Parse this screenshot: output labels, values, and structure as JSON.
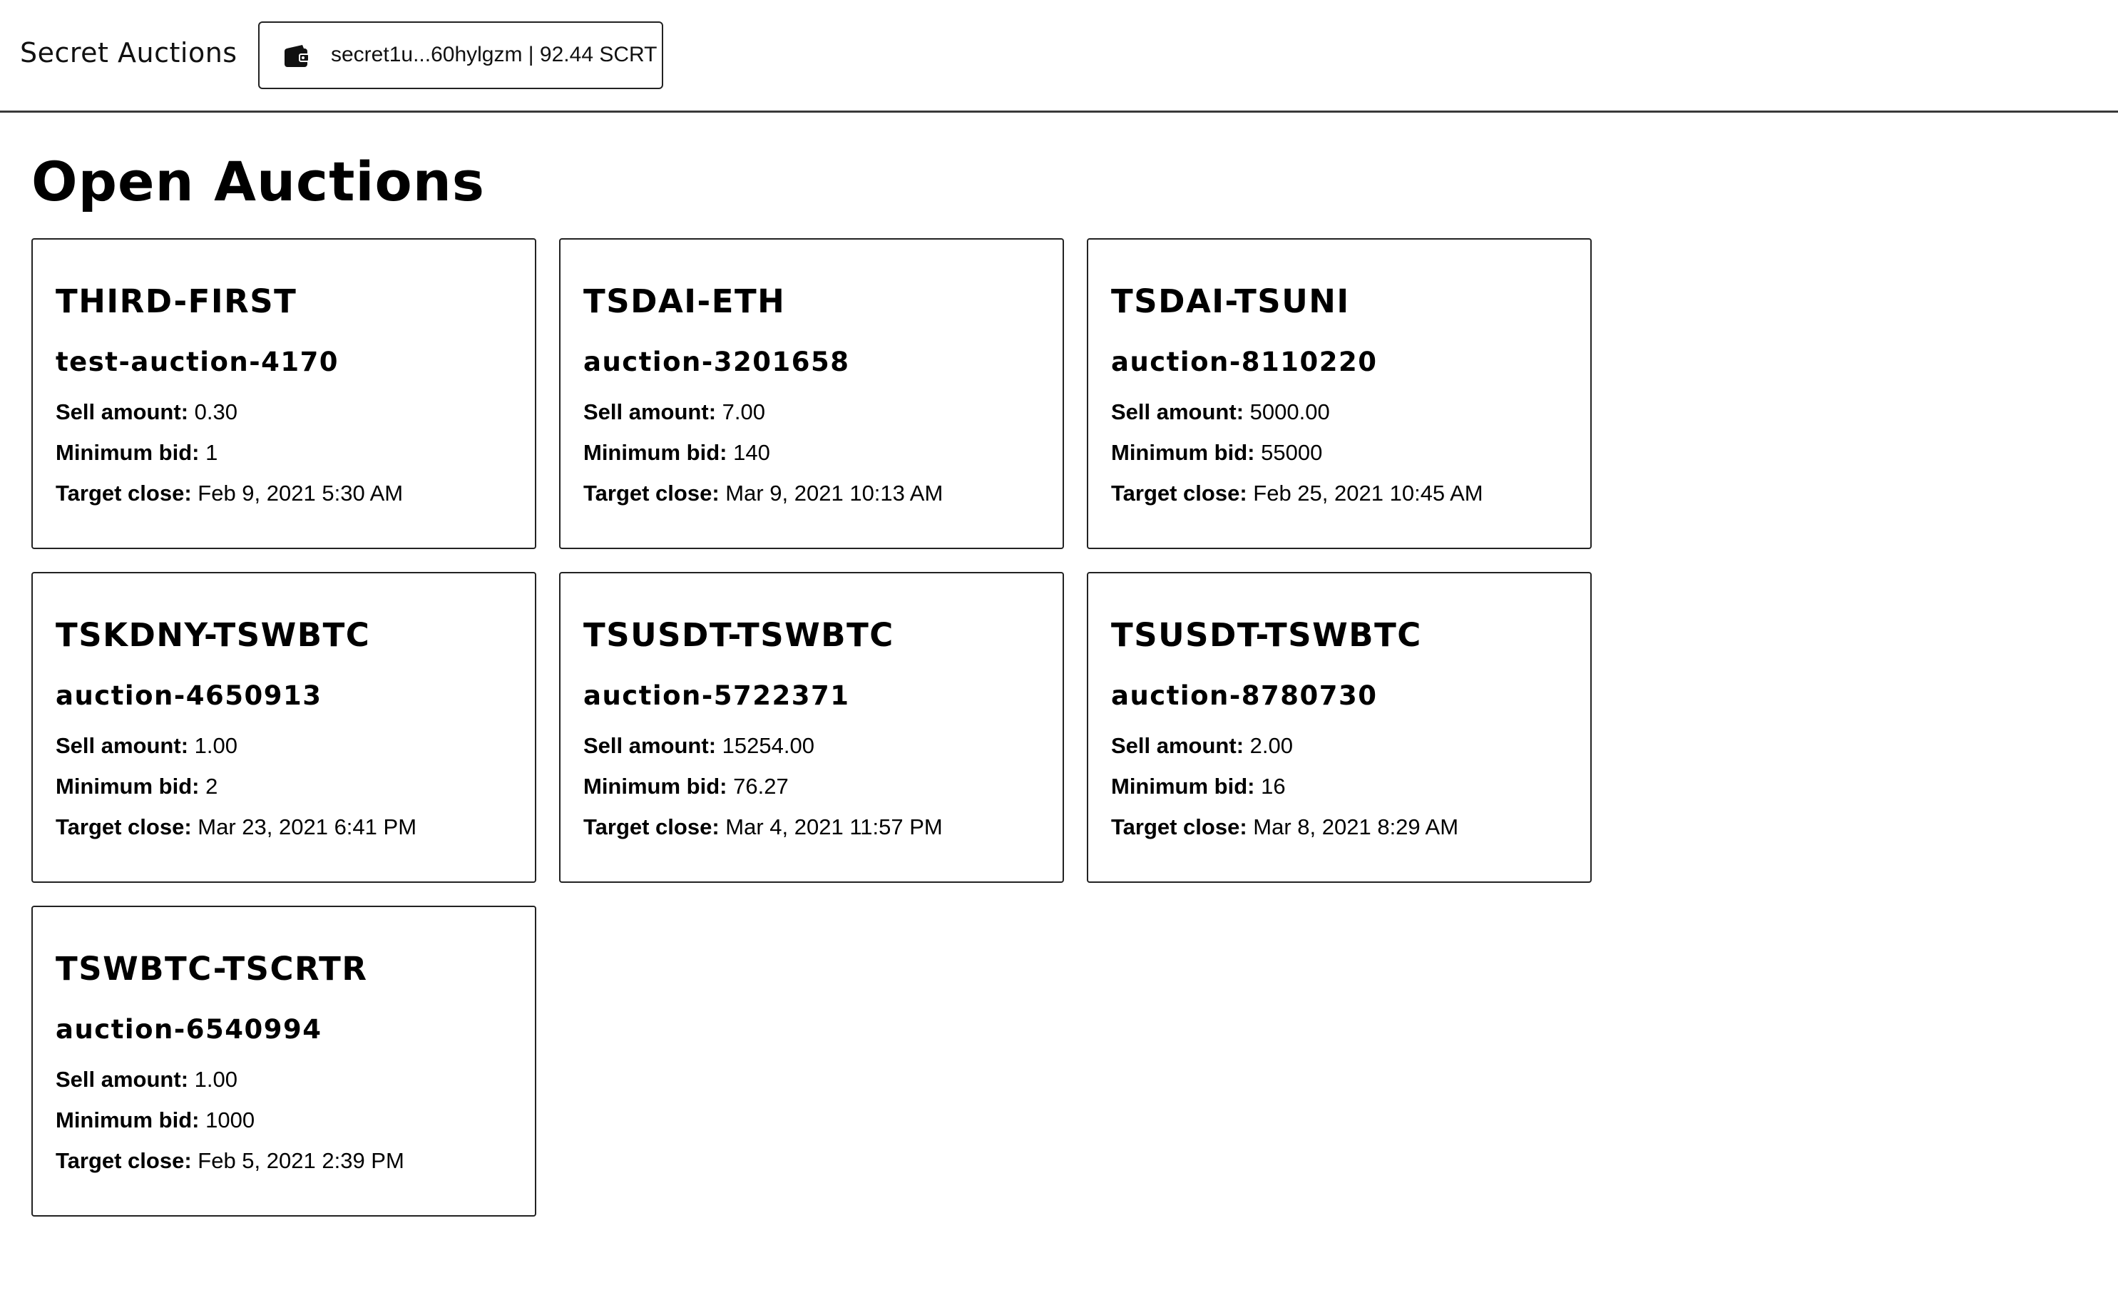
{
  "header": {
    "app_title": "Secret Auctions",
    "wallet": {
      "label": "secret1u...60hylgzm | 92.44 SCRT",
      "icon": "wallet-icon"
    }
  },
  "main": {
    "title": "Open Auctions",
    "field_labels": {
      "sell_amount": "Sell amount:",
      "minimum_bid": "Minimum bid:",
      "target_close": "Target close:"
    },
    "auctions": [
      {
        "pair": "THIRD-FIRST",
        "id": "test-auction-4170",
        "sell_amount": "0.30",
        "minimum_bid": "1",
        "target_close": "Feb 9, 2021 5:30 AM"
      },
      {
        "pair": "TSDAI-ETH",
        "id": "auction-3201658",
        "sell_amount": "7.00",
        "minimum_bid": "140",
        "target_close": "Mar 9, 2021 10:13 AM"
      },
      {
        "pair": "TSDAI-TSUNI",
        "id": "auction-8110220",
        "sell_amount": "5000.00",
        "minimum_bid": "55000",
        "target_close": "Feb 25, 2021 10:45 AM"
      },
      {
        "pair": "TSKDNY-TSWBTC",
        "id": "auction-4650913",
        "sell_amount": "1.00",
        "minimum_bid": "2",
        "target_close": "Mar 23, 2021 6:41 PM"
      },
      {
        "pair": "TSUSDT-TSWBTC",
        "id": "auction-5722371",
        "sell_amount": "15254.00",
        "minimum_bid": "76.27",
        "target_close": "Mar 4, 2021 11:57 PM"
      },
      {
        "pair": "TSUSDT-TSWBTC",
        "id": "auction-8780730",
        "sell_amount": "2.00",
        "minimum_bid": "16",
        "target_close": "Mar 8, 2021 8:29 AM"
      },
      {
        "pair": "TSWBTC-TSCRTR",
        "id": "auction-6540994",
        "sell_amount": "1.00",
        "minimum_bid": "1000",
        "target_close": "Feb 5, 2021 2:39 PM"
      }
    ]
  },
  "colors": {
    "text": "#000000",
    "border": "#222222",
    "background": "#ffffff"
  }
}
